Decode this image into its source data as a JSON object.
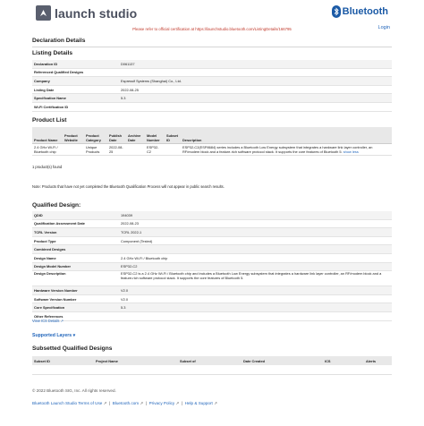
{
  "header": {
    "logo_text": "launch studio",
    "bluetooth_text": "Bluetooth",
    "notice": "Please refer to official certification at https://launchstudio.bluetooth.com/ListingDetails/166795",
    "login": "Login"
  },
  "page_title": "Declaration Details",
  "listing": {
    "title": "Listing Details",
    "rows": [
      {
        "label": "Declaration ID",
        "value": "D061137"
      },
      {
        "label": "Referenced Qualified Designs",
        "value": ""
      },
      {
        "label": "Company",
        "value": "Espressif Systems (Shanghai) Co., Ltd."
      },
      {
        "label": "Listing Date",
        "value": "2022-08-25"
      },
      {
        "label": "Specification Name",
        "value": "5.3"
      },
      {
        "label": "Wi-Fi Certification ID",
        "value": ""
      }
    ]
  },
  "product_list": {
    "title": "Product List",
    "headers": [
      "Product Name",
      "Product Website",
      "Product Category",
      "Publish Date",
      "Archive Date",
      "Model Number",
      "Subset ID",
      "Description"
    ],
    "row": {
      "name": "2.4 GHz Wi-Fi / Bluetooth chip",
      "website": "",
      "category": "Unique Products",
      "publish": "2022-08-25",
      "archive": "",
      "model": "ESP32-C2",
      "subset": "",
      "description": "ESP32-C2(ESP8684) series includes a Bluetooth Low Energy subsystem that integrates a hardware link layer controller, an RF/modem block and a feature-rich software protocol stack. It supports the core features of Bluetooth 5.",
      "show_less": "show less"
    },
    "found": "1 product(s) found",
    "note": "Note: Products that have not yet completed the Bluetooth Qualification Process will not appear in public search results."
  },
  "qualified": {
    "title": "Qualified Design:",
    "rows": [
      {
        "label": "QDID",
        "value": "194039"
      },
      {
        "label": "Qualification Assessment Date",
        "value": "2022-08-23"
      },
      {
        "label": "TCRL Version",
        "value": "TCRL 2022-1"
      },
      {
        "label": "Product Type",
        "value": "Component (Tested)"
      },
      {
        "label": "Combined Designs",
        "value": ""
      },
      {
        "label": "Design Name",
        "value": "2.4 GHz Wi-Fi / Bluetooth chip"
      },
      {
        "label": "Design Model Number",
        "value": "ESP32-C2"
      },
      {
        "label": "Design Description",
        "value": "ESP32-C2 is a 2.4 GHz Wi-Fi / Bluetooth chip and includes a Bluetooth Low Energy subsystem that integrates a hardware link layer controller, an RF/modem block and a feature-rich software protocol stack. It supports the core features of Bluetooth 5."
      },
      {
        "label": "Hardware Version Number",
        "value": "V2.0"
      },
      {
        "label": "Software Version Number",
        "value": "V2.0"
      },
      {
        "label": "Core Specification",
        "value": "5.3"
      },
      {
        "label": "Other References",
        "value": ""
      }
    ],
    "view_ics": "View ICS Details"
  },
  "supported_layers": "Supported Layers",
  "subset": {
    "title": "Subsetted Qualified Designs",
    "headers": [
      "Subset ID",
      "Project Name",
      "Subset of",
      "Date Created",
      "ICS",
      "Alerts"
    ]
  },
  "footer": {
    "copyright": "© 2022 Bluetooth SIG, Inc. All rights reserved.",
    "links": [
      "Bluetooth Launch Studio Terms of Use",
      "Bluetooth.com",
      "Privacy Policy",
      "Help & Support"
    ]
  }
}
